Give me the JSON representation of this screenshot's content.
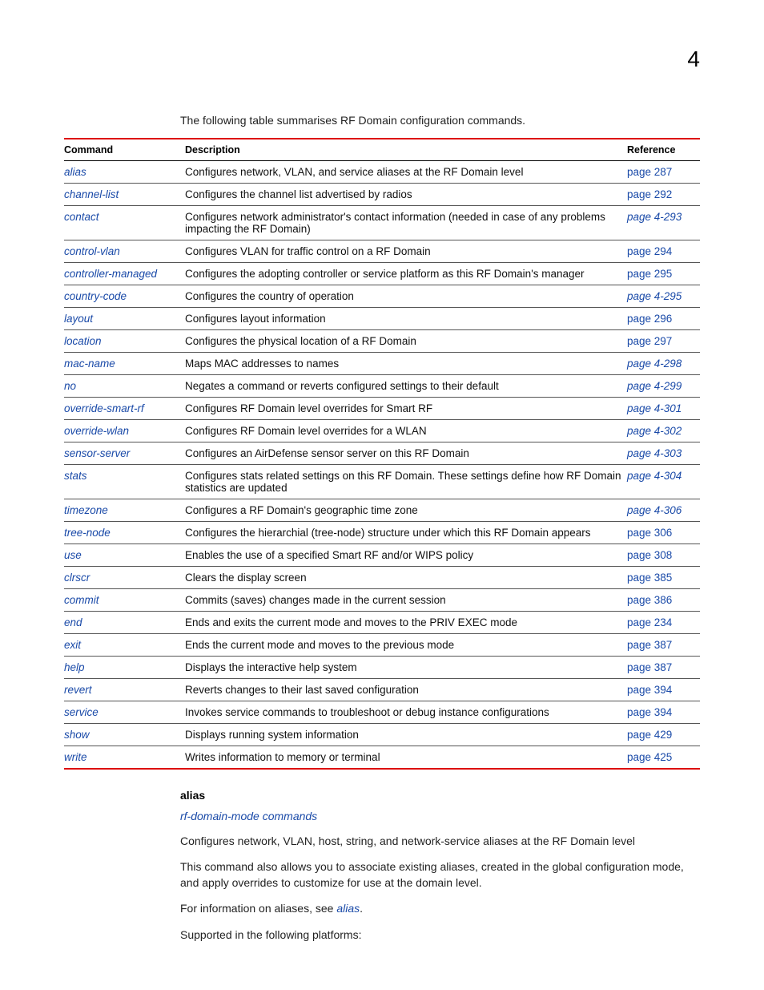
{
  "pageNumber": "4",
  "introText": "The following table summarises RF Domain configuration commands.",
  "table": {
    "headers": {
      "command": "Command",
      "description": "Description",
      "reference": "Reference"
    },
    "rows": [
      {
        "command": "alias",
        "description": "Configures network, VLAN, and service aliases at the RF Domain level",
        "reference": "page 287",
        "refItalic": false
      },
      {
        "command": "channel-list",
        "description": "Configures the channel list advertised by radios",
        "reference": "page 292",
        "refItalic": false
      },
      {
        "command": "contact",
        "description": "Configures network administrator's contact information (needed in case of any problems impacting the RF Domain)",
        "reference": "page 4-293",
        "refItalic": true
      },
      {
        "command": "control-vlan",
        "description": "Configures VLAN for traffic control on a RF Domain",
        "reference": "page 294",
        "refItalic": false
      },
      {
        "command": "controller-managed",
        "description": "Configures the adopting controller or service platform as this RF Domain's manager",
        "reference": "page 295",
        "refItalic": false
      },
      {
        "command": "country-code",
        "description": "Configures the country of operation",
        "reference": "page 4-295",
        "refItalic": true
      },
      {
        "command": "layout",
        "description": "Configures layout information",
        "reference": "page 296",
        "refItalic": false
      },
      {
        "command": "location",
        "description": "Configures the physical location of a RF Domain",
        "reference": "page 297",
        "refItalic": false
      },
      {
        "command": "mac-name",
        "description": "Maps MAC addresses to names",
        "reference": "page 4-298",
        "refItalic": true
      },
      {
        "command": "no",
        "description": "Negates a command or reverts configured settings to their default",
        "reference": "page 4-299",
        "refItalic": true
      },
      {
        "command": "override-smart-rf",
        "description": "Configures RF Domain level overrides for Smart RF",
        "reference": "page 4-301",
        "refItalic": true
      },
      {
        "command": "override-wlan",
        "description": "Configures RF Domain level overrides for a WLAN",
        "reference": "page 4-302",
        "refItalic": true
      },
      {
        "command": "sensor-server",
        "description": "Configures an AirDefense sensor server on this RF Domain",
        "reference": "page 4-303",
        "refItalic": true
      },
      {
        "command": "stats",
        "description": "Configures stats related settings on this RF Domain. These settings define how RF Domain statistics are updated",
        "reference": "page 4-304",
        "refItalic": true
      },
      {
        "command": "timezone",
        "description": "Configures a RF Domain's geographic time zone",
        "reference": "page 4-306",
        "refItalic": true
      },
      {
        "command": "tree-node",
        "description": "Configures the hierarchial (tree-node) structure under which this RF Domain appears",
        "reference": "page 306",
        "refItalic": false
      },
      {
        "command": "use",
        "description": "Enables the use of a specified Smart RF and/or WIPS policy",
        "reference": "page 308",
        "refItalic": false
      },
      {
        "command": "clrscr",
        "description": "Clears the display screen",
        "reference": "page 385",
        "refItalic": false
      },
      {
        "command": "commit",
        "description": "Commits (saves) changes made in the current session",
        "reference": "page 386",
        "refItalic": false
      },
      {
        "command": "end",
        "description": "Ends and exits the current mode and moves to the PRIV EXEC mode",
        "reference": "page 234",
        "refItalic": false
      },
      {
        "command": "exit",
        "description": "Ends the current mode and moves to the previous mode",
        "reference": "page 387",
        "refItalic": false
      },
      {
        "command": "help",
        "description": "Displays the interactive help system",
        "reference": "page 387",
        "refItalic": false
      },
      {
        "command": "revert",
        "description": "Reverts changes to their last saved configuration",
        "reference": "page 394",
        "refItalic": false
      },
      {
        "command": "service",
        "description": "Invokes service commands to troubleshoot or debug                                          instance configurations",
        "reference": "page 394",
        "refItalic": false
      },
      {
        "command": "show",
        "description": "Displays running system information",
        "reference": "page 429",
        "refItalic": false
      },
      {
        "command": "write",
        "description": "Writes information to memory or terminal",
        "reference": "page 425",
        "refItalic": false
      }
    ]
  },
  "section": {
    "heading": "alias",
    "subhead": "rf-domain-mode commands",
    "para1": "Configures network, VLAN, host, string, and network-service aliases at the RF Domain level",
    "para2": "This command also allows you to associate existing aliases, created in the global configuration mode, and apply overrides to customize for use at the domain level.",
    "para3_prefix": "For information on aliases, see ",
    "para3_link": "alias",
    "para3_suffix": ".",
    "para4": "Supported in the following platforms:"
  }
}
